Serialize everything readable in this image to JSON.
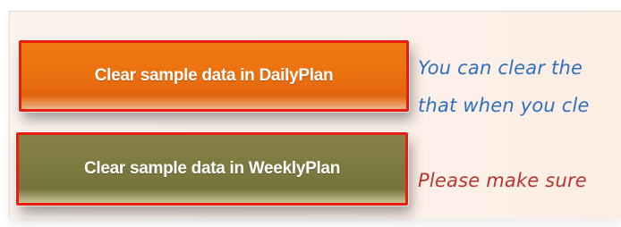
{
  "buttons": {
    "daily_label": "Clear sample data in DailyPlan",
    "weekly_label": "Clear sample data in WeeklyPlan"
  },
  "notes": {
    "line1": "You can clear the",
    "line2": "that when you cle",
    "warning": "Please make sure"
  },
  "colors": {
    "daily_button": "#ec7210",
    "weekly_button": "#7d7a40",
    "button_border": "#e81d10",
    "note_text": "#2e6fbf",
    "warning_text": "#b8352f"
  }
}
